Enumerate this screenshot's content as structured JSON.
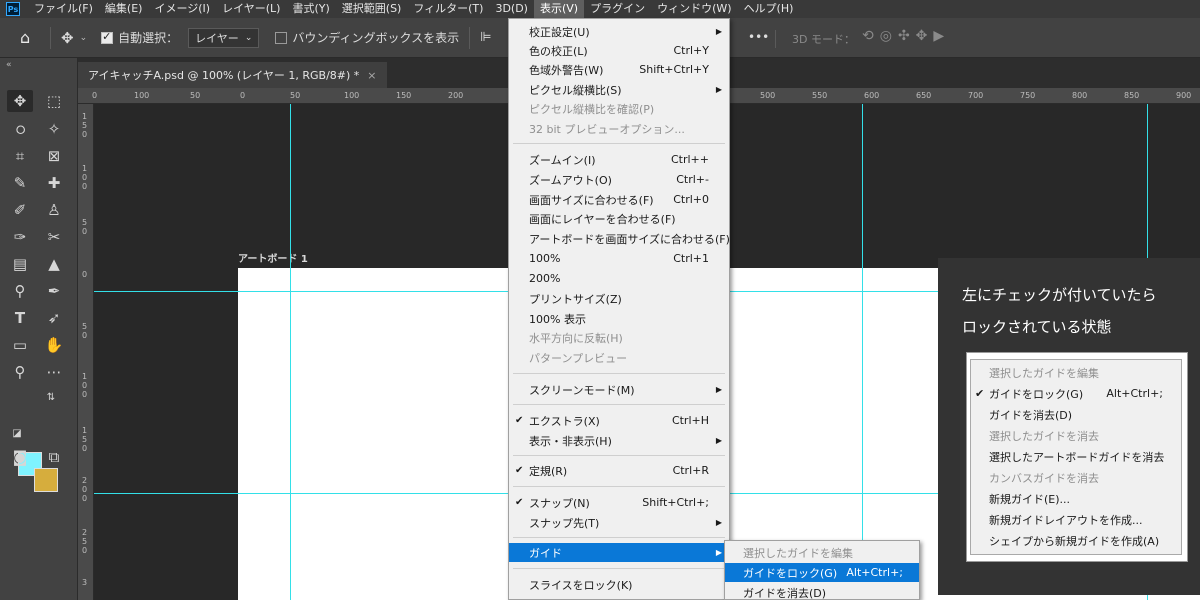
{
  "app": {
    "logo": "Ps"
  },
  "menubar": [
    "ファイル(F)",
    "編集(E)",
    "イメージ(I)",
    "レイヤー(L)",
    "書式(Y)",
    "選択範囲(S)",
    "フィルター(T)",
    "3D(D)",
    "表示(V)",
    "プラグイン",
    "ウィンドウ(W)",
    "ヘルプ(H)"
  ],
  "options": {
    "auto_select_label": "自動選択：",
    "auto_select_value": "レイヤー",
    "bbox_label": "バウンディングボックスを表示",
    "more": "•••",
    "mode3d": "3D モード："
  },
  "tab": {
    "title": "アイキャッチA.psd @ 100% (レイヤー 1, RGB/8#) *",
    "close": "×"
  },
  "ruler": {
    "h": [
      "0",
      "100",
      "50",
      "0",
      "50",
      "100",
      "150",
      "200",
      "500",
      "550",
      "600",
      "650",
      "700",
      "750",
      "800",
      "850",
      "900"
    ],
    "v": [
      "1 5 0",
      "1 0 0",
      "5 0",
      "0",
      "5 0",
      "1 0 0",
      "1 5 0",
      "2 0 0",
      "2 5 0",
      "3 0 0",
      "3"
    ]
  },
  "artboard_label": "アートボード 1",
  "view_menu": {
    "items": [
      {
        "label": "校正設定(U)",
        "shortcut": "",
        "arrow": true,
        "disabled": false
      },
      {
        "label": "色の校正(L)",
        "shortcut": "Ctrl+Y"
      },
      {
        "label": "色域外警告(W)",
        "shortcut": "Shift+Ctrl+Y"
      },
      {
        "label": "ピクセル縦横比(S)",
        "shortcut": "",
        "arrow": true
      },
      {
        "label": "ピクセル縦横比を確認(P)",
        "shortcut": "",
        "disabled": true
      },
      {
        "label": "32 bit プレビューオプション...",
        "shortcut": "",
        "disabled": true
      },
      {
        "label": "ズームイン(I)",
        "shortcut": "Ctrl++"
      },
      {
        "label": "ズームアウト(O)",
        "shortcut": "Ctrl+-"
      },
      {
        "label": "画面サイズに合わせる(F)",
        "shortcut": "Ctrl+0"
      },
      {
        "label": "画面にレイヤーを合わせる(F)",
        "shortcut": ""
      },
      {
        "label": "アートボードを画面サイズに合わせる(F)",
        "shortcut": ""
      },
      {
        "label": "100%",
        "shortcut": "Ctrl+1"
      },
      {
        "label": "200%",
        "shortcut": ""
      },
      {
        "label": "プリントサイズ(Z)",
        "shortcut": ""
      },
      {
        "label": "100% 表示",
        "shortcut": ""
      },
      {
        "label": "水平方向に反転(H)",
        "shortcut": "",
        "disabled": true
      },
      {
        "label": "パターンプレビュー",
        "shortcut": "",
        "disabled": true
      },
      {
        "label": "スクリーンモード(M)",
        "shortcut": "",
        "arrow": true
      },
      {
        "label": "エクストラ(X)",
        "shortcut": "Ctrl+H",
        "checked": true
      },
      {
        "label": "表示・非表示(H)",
        "shortcut": "",
        "arrow": true
      },
      {
        "label": "定規(R)",
        "shortcut": "Ctrl+R",
        "checked": true
      },
      {
        "label": "スナップ(N)",
        "shortcut": "Shift+Ctrl+;",
        "checked": true
      },
      {
        "label": "スナップ先(T)",
        "shortcut": "",
        "arrow": true
      },
      {
        "label": "ガイド",
        "shortcut": "",
        "arrow": true,
        "highlight": true
      },
      {
        "label": "スライスをロック(K)",
        "shortcut": ""
      }
    ]
  },
  "guide_submenu": [
    {
      "label": "選択したガイドを編集",
      "shortcut": "",
      "disabled": true
    },
    {
      "label": "ガイドをロック(G)",
      "shortcut": "Alt+Ctrl+;",
      "highlight": true
    },
    {
      "label": "ガイドを消去(D)",
      "shortcut": ""
    }
  ],
  "callout": {
    "line1": "左にチェックが付いていたら",
    "line2": "ロックされている状態"
  },
  "inset_menu": [
    {
      "label": "選択したガイドを編集",
      "shortcut": "",
      "disabled": true
    },
    {
      "label": "ガイドをロック(G)",
      "shortcut": "Alt+Ctrl+;",
      "checked": true
    },
    {
      "label": "ガイドを消去(D)",
      "shortcut": ""
    },
    {
      "label": "選択したガイドを消去",
      "shortcut": "",
      "disabled": true
    },
    {
      "label": "選択したアートボードガイドを消去",
      "shortcut": ""
    },
    {
      "label": "カンバスガイドを消去",
      "shortcut": "",
      "disabled": true
    },
    {
      "label": "新規ガイド(E)...",
      "shortcut": ""
    },
    {
      "label": "新規ガイドレイアウトを作成...",
      "shortcut": ""
    },
    {
      "label": "シェイプから新規ガイドを作成(A)",
      "shortcut": ""
    }
  ],
  "colors": {
    "foreground": "#7ff3ff",
    "background": "#d6ad3d",
    "guide": "#33e0e8",
    "highlight": "#0a78d7"
  }
}
